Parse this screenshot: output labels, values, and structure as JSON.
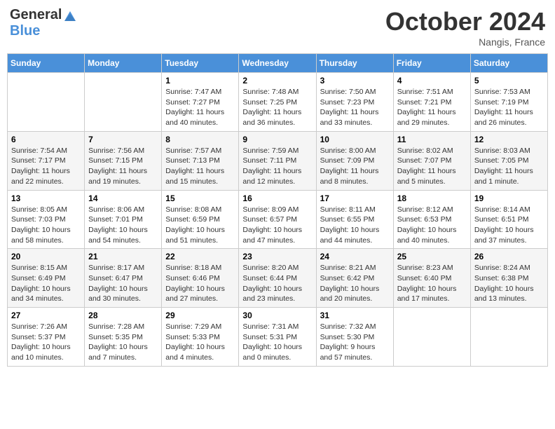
{
  "header": {
    "logo_general": "General",
    "logo_blue": "Blue",
    "month_title": "October 2024",
    "subtitle": "Nangis, France"
  },
  "days_of_week": [
    "Sunday",
    "Monday",
    "Tuesday",
    "Wednesday",
    "Thursday",
    "Friday",
    "Saturday"
  ],
  "weeks": [
    [
      {
        "day": "",
        "info": ""
      },
      {
        "day": "",
        "info": ""
      },
      {
        "day": "1",
        "info": "Sunrise: 7:47 AM\nSunset: 7:27 PM\nDaylight: 11 hours and 40 minutes."
      },
      {
        "day": "2",
        "info": "Sunrise: 7:48 AM\nSunset: 7:25 PM\nDaylight: 11 hours and 36 minutes."
      },
      {
        "day": "3",
        "info": "Sunrise: 7:50 AM\nSunset: 7:23 PM\nDaylight: 11 hours and 33 minutes."
      },
      {
        "day": "4",
        "info": "Sunrise: 7:51 AM\nSunset: 7:21 PM\nDaylight: 11 hours and 29 minutes."
      },
      {
        "day": "5",
        "info": "Sunrise: 7:53 AM\nSunset: 7:19 PM\nDaylight: 11 hours and 26 minutes."
      }
    ],
    [
      {
        "day": "6",
        "info": "Sunrise: 7:54 AM\nSunset: 7:17 PM\nDaylight: 11 hours and 22 minutes."
      },
      {
        "day": "7",
        "info": "Sunrise: 7:56 AM\nSunset: 7:15 PM\nDaylight: 11 hours and 19 minutes."
      },
      {
        "day": "8",
        "info": "Sunrise: 7:57 AM\nSunset: 7:13 PM\nDaylight: 11 hours and 15 minutes."
      },
      {
        "day": "9",
        "info": "Sunrise: 7:59 AM\nSunset: 7:11 PM\nDaylight: 11 hours and 12 minutes."
      },
      {
        "day": "10",
        "info": "Sunrise: 8:00 AM\nSunset: 7:09 PM\nDaylight: 11 hours and 8 minutes."
      },
      {
        "day": "11",
        "info": "Sunrise: 8:02 AM\nSunset: 7:07 PM\nDaylight: 11 hours and 5 minutes."
      },
      {
        "day": "12",
        "info": "Sunrise: 8:03 AM\nSunset: 7:05 PM\nDaylight: 11 hours and 1 minute."
      }
    ],
    [
      {
        "day": "13",
        "info": "Sunrise: 8:05 AM\nSunset: 7:03 PM\nDaylight: 10 hours and 58 minutes."
      },
      {
        "day": "14",
        "info": "Sunrise: 8:06 AM\nSunset: 7:01 PM\nDaylight: 10 hours and 54 minutes."
      },
      {
        "day": "15",
        "info": "Sunrise: 8:08 AM\nSunset: 6:59 PM\nDaylight: 10 hours and 51 minutes."
      },
      {
        "day": "16",
        "info": "Sunrise: 8:09 AM\nSunset: 6:57 PM\nDaylight: 10 hours and 47 minutes."
      },
      {
        "day": "17",
        "info": "Sunrise: 8:11 AM\nSunset: 6:55 PM\nDaylight: 10 hours and 44 minutes."
      },
      {
        "day": "18",
        "info": "Sunrise: 8:12 AM\nSunset: 6:53 PM\nDaylight: 10 hours and 40 minutes."
      },
      {
        "day": "19",
        "info": "Sunrise: 8:14 AM\nSunset: 6:51 PM\nDaylight: 10 hours and 37 minutes."
      }
    ],
    [
      {
        "day": "20",
        "info": "Sunrise: 8:15 AM\nSunset: 6:49 PM\nDaylight: 10 hours and 34 minutes."
      },
      {
        "day": "21",
        "info": "Sunrise: 8:17 AM\nSunset: 6:47 PM\nDaylight: 10 hours and 30 minutes."
      },
      {
        "day": "22",
        "info": "Sunrise: 8:18 AM\nSunset: 6:46 PM\nDaylight: 10 hours and 27 minutes."
      },
      {
        "day": "23",
        "info": "Sunrise: 8:20 AM\nSunset: 6:44 PM\nDaylight: 10 hours and 23 minutes."
      },
      {
        "day": "24",
        "info": "Sunrise: 8:21 AM\nSunset: 6:42 PM\nDaylight: 10 hours and 20 minutes."
      },
      {
        "day": "25",
        "info": "Sunrise: 8:23 AM\nSunset: 6:40 PM\nDaylight: 10 hours and 17 minutes."
      },
      {
        "day": "26",
        "info": "Sunrise: 8:24 AM\nSunset: 6:38 PM\nDaylight: 10 hours and 13 minutes."
      }
    ],
    [
      {
        "day": "27",
        "info": "Sunrise: 7:26 AM\nSunset: 5:37 PM\nDaylight: 10 hours and 10 minutes."
      },
      {
        "day": "28",
        "info": "Sunrise: 7:28 AM\nSunset: 5:35 PM\nDaylight: 10 hours and 7 minutes."
      },
      {
        "day": "29",
        "info": "Sunrise: 7:29 AM\nSunset: 5:33 PM\nDaylight: 10 hours and 4 minutes."
      },
      {
        "day": "30",
        "info": "Sunrise: 7:31 AM\nSunset: 5:31 PM\nDaylight: 10 hours and 0 minutes."
      },
      {
        "day": "31",
        "info": "Sunrise: 7:32 AM\nSunset: 5:30 PM\nDaylight: 9 hours and 57 minutes."
      },
      {
        "day": "",
        "info": ""
      },
      {
        "day": "",
        "info": ""
      }
    ]
  ]
}
